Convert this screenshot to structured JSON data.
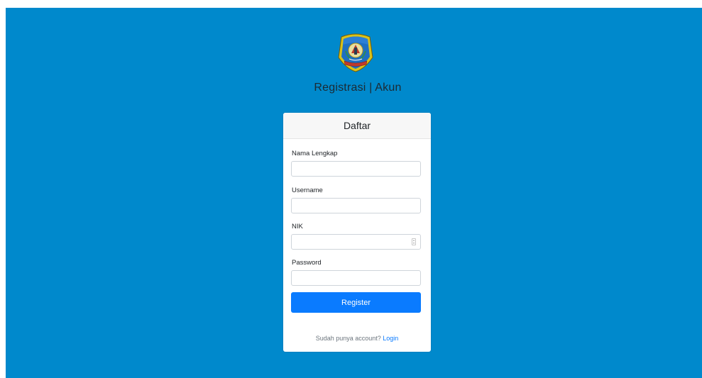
{
  "header": {
    "title": "Registrasi | Akun",
    "logo": "regional-emblem-shield"
  },
  "form": {
    "title": "Daftar",
    "fields": [
      {
        "label": "Nama Lengkap",
        "value": "",
        "type": "text"
      },
      {
        "label": "Username",
        "value": "",
        "type": "text"
      },
      {
        "label": "NIK",
        "value": "",
        "type": "number"
      },
      {
        "label": "Password",
        "value": "",
        "type": "password"
      }
    ],
    "submit_label": "Register",
    "footer_text": "Sudah punya account?",
    "login_link": "Login"
  },
  "colors": {
    "background": "#0089cc",
    "primary": "#0a7bff",
    "card": "#ffffff"
  }
}
